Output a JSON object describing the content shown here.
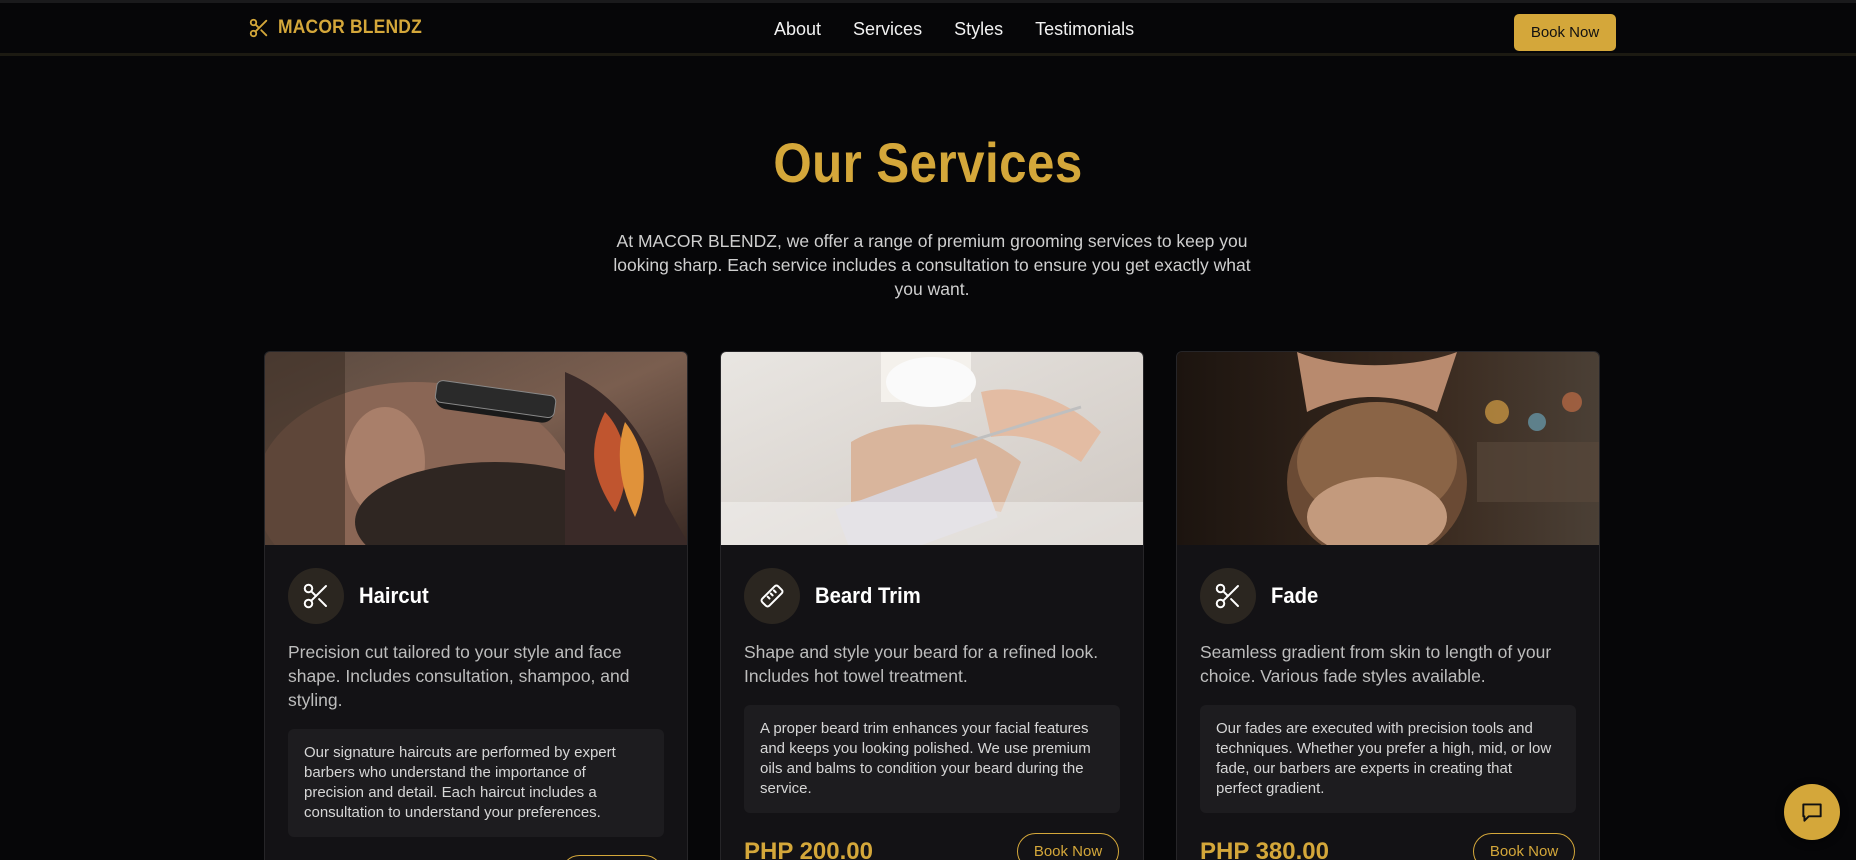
{
  "header": {
    "brand": "MACOR BLENDZ",
    "nav": [
      "About",
      "Services",
      "Styles",
      "Testimonials"
    ],
    "cta": "Book Now"
  },
  "section": {
    "title": "Our Services",
    "intro": "At MACOR BLENDZ, we offer a range of premium grooming services to keep you looking sharp. Each service includes a consultation to ensure you get exactly what you want."
  },
  "services": [
    {
      "icon": "scissors-icon",
      "title": "Haircut",
      "description": "Precision cut tailored to your style and face shape. Includes consultation, shampoo, and styling.",
      "detail": "Our signature haircuts are performed by expert barbers who understand the importance of precision and detail. Each haircut includes a consultation to understand your preferences.",
      "price": "",
      "button": ""
    },
    {
      "icon": "razor-icon",
      "title": "Beard Trim",
      "description": "Shape and style your beard for a refined look. Includes hot towel treatment.",
      "detail": "A proper beard trim enhances your facial features and keeps you looking polished. We use premium oils and balms to condition your beard during the service.",
      "price": "PHP 200.00",
      "button": "Book Now"
    },
    {
      "icon": "scissors-icon",
      "title": "Fade",
      "description": "Seamless gradient from skin to length of your choice. Various fade styles available.",
      "detail": "Our fades are executed with precision tools and techniques. Whether you prefer a high, mid, or low fade, our barbers are experts in creating that perfect gradient.",
      "price": "PHP 380.00",
      "button": "Book Now"
    }
  ],
  "colors": {
    "accent": "#d4a73a",
    "background": "#060608",
    "card": "#131215"
  },
  "chat": {
    "icon": "chat-bubble-icon"
  }
}
